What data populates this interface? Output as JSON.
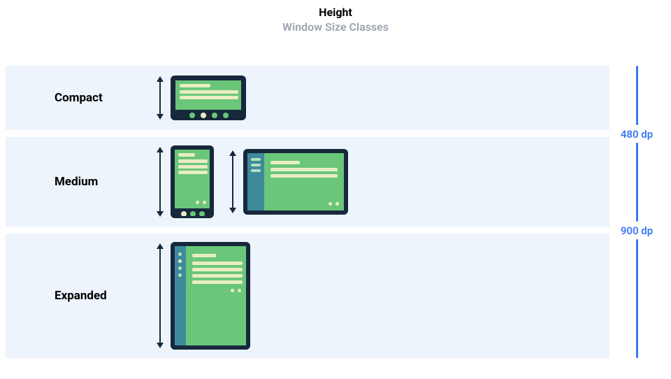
{
  "header": {
    "title": "Height",
    "subtitle": "Window Size Classes"
  },
  "rows": {
    "compact": {
      "label": "Compact"
    },
    "medium": {
      "label": "Medium"
    },
    "expanded": {
      "label": "Expanded"
    }
  },
  "breakpoints": {
    "first": "480 dp",
    "second": "900 dp"
  }
}
